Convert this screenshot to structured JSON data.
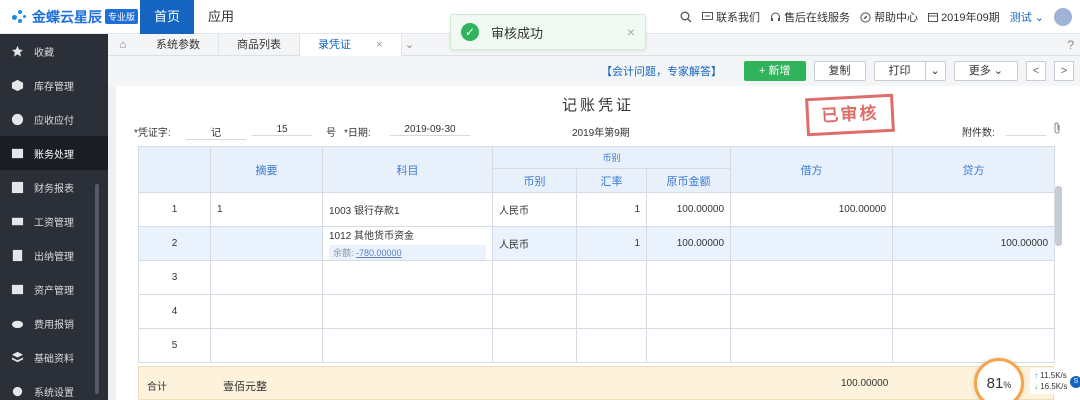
{
  "app": {
    "logo_text": "金蝶云星辰",
    "logo_badge": "专业版",
    "nav_tabs": [
      "首页",
      "应用"
    ],
    "top_right": {
      "contact": "联系我们",
      "service": "售后在线服务",
      "help": "帮助中心",
      "period": "2019年09期",
      "user": "测试"
    }
  },
  "toast": {
    "message": "审核成功",
    "close": "×"
  },
  "sidebar": {
    "items": [
      {
        "label": "收藏",
        "icon": "star-icon"
      },
      {
        "label": "库存管理",
        "icon": "box-icon"
      },
      {
        "label": "应收应付",
        "icon": "money-icon"
      },
      {
        "label": "账务处理",
        "icon": "ledger-icon"
      },
      {
        "label": "财务报表",
        "icon": "report-icon"
      },
      {
        "label": "工资管理",
        "icon": "salary-icon"
      },
      {
        "label": "出纳管理",
        "icon": "cashier-icon"
      },
      {
        "label": "资产管理",
        "icon": "asset-icon"
      },
      {
        "label": "费用报销",
        "icon": "expense-icon"
      },
      {
        "label": "基础资料",
        "icon": "base-data-icon"
      },
      {
        "label": "系统设置",
        "icon": "settings-icon"
      }
    ]
  },
  "page_tabs": [
    {
      "label": "系统参数"
    },
    {
      "label": "商品列表"
    },
    {
      "label": "录凭证",
      "close": "×"
    }
  ],
  "toolbar": {
    "help_link": "【会计问题，专家解答】",
    "new_label": "+ 新增",
    "copy_label": "复制",
    "print_label": "打印",
    "more_label": "更多",
    "prev": "<",
    "next": ">"
  },
  "voucher": {
    "title": "记账凭证",
    "stamp": "已审核",
    "word_label": "*凭证字:",
    "word_value": "记",
    "number": "15",
    "number_suffix": "号",
    "date_label": "*日期:",
    "date_value": "2019-09-30",
    "period": "2019年第9期",
    "attachments_label": "附件数:",
    "headers": {
      "summary": "摘要",
      "account": "科目",
      "currency_group": "币别",
      "currency": "币别",
      "rate": "汇率",
      "orig_amount": "原币金额",
      "debit": "借方",
      "credit": "贷方"
    },
    "rows": [
      {
        "no": "1",
        "summary": "1",
        "account": "1003 银行存款1",
        "balance_label": "",
        "balance": "",
        "currency": "人民币",
        "rate": "1",
        "orig": "100.00000",
        "debit": "100.00000",
        "credit": ""
      },
      {
        "no": "2",
        "summary": "",
        "account": "1012 其他货币资金",
        "balance_label": "余额:",
        "balance": "-780.00000",
        "currency": "人民币",
        "rate": "1",
        "orig": "100.00000",
        "debit": "",
        "credit": "100.00000"
      },
      {
        "no": "3",
        "summary": "",
        "account": "",
        "balance_label": "",
        "balance": "",
        "currency": "",
        "rate": "",
        "orig": "",
        "debit": "",
        "credit": ""
      },
      {
        "no": "4",
        "summary": "",
        "account": "",
        "balance_label": "",
        "balance": "",
        "currency": "",
        "rate": "",
        "orig": "",
        "debit": "",
        "credit": ""
      },
      {
        "no": "5",
        "summary": "",
        "account": "",
        "balance_label": "",
        "balance": "",
        "currency": "",
        "rate": "",
        "orig": "",
        "debit": "",
        "credit": ""
      }
    ],
    "total": {
      "label": "合计",
      "words": "壹佰元整",
      "debit": "100.00000"
    }
  },
  "speed_widget": {
    "percent": "81",
    "percent_unit": "%",
    "upload": "11.5K/s",
    "download": "16.5K/s",
    "badge": "S"
  }
}
